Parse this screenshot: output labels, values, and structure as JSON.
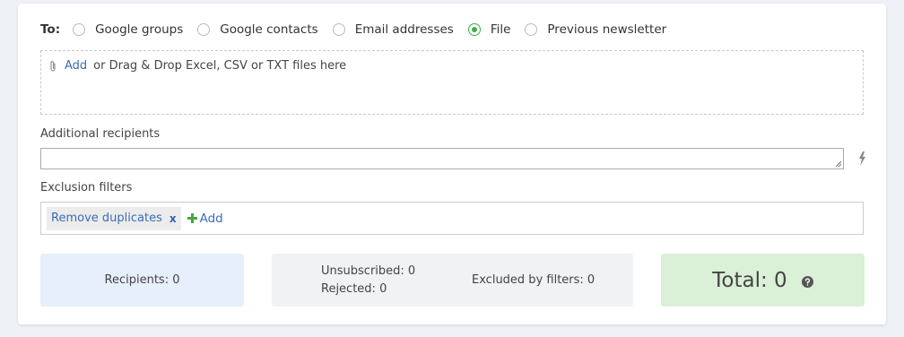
{
  "to": {
    "label": "To:",
    "options": [
      {
        "label": "Google groups",
        "checked": false
      },
      {
        "label": "Google contacts",
        "checked": false
      },
      {
        "label": "Email addresses",
        "checked": false
      },
      {
        "label": "File",
        "checked": true
      },
      {
        "label": "Previous newsletter",
        "checked": false
      }
    ]
  },
  "dropzone": {
    "add_link": "Add",
    "hint": "or Drag & Drop Excel, CSV or TXT files here",
    "icon": "paperclip-icon"
  },
  "additional_recipients": {
    "label": "Additional recipients",
    "value": "",
    "action_icon": "bolt-icon"
  },
  "exclusion_filters": {
    "label": "Exclusion filters",
    "tags": [
      {
        "label": "Remove duplicates",
        "remove": "x"
      }
    ],
    "add_label": "Add"
  },
  "summary": {
    "recipients": "Recipients: 0",
    "unsubscribed": "Unsubscribed: 0",
    "rejected": "Rejected: 0",
    "excluded": "Excluded by filters: 0",
    "total": "Total: 0",
    "help_icon": "help-icon"
  },
  "colors": {
    "accent_green": "#3fae49",
    "link_blue": "#3b6db3",
    "recipients_bg": "#e7eefc",
    "stats_bg": "#f1f2f4",
    "total_bg": "#daf0d7"
  }
}
